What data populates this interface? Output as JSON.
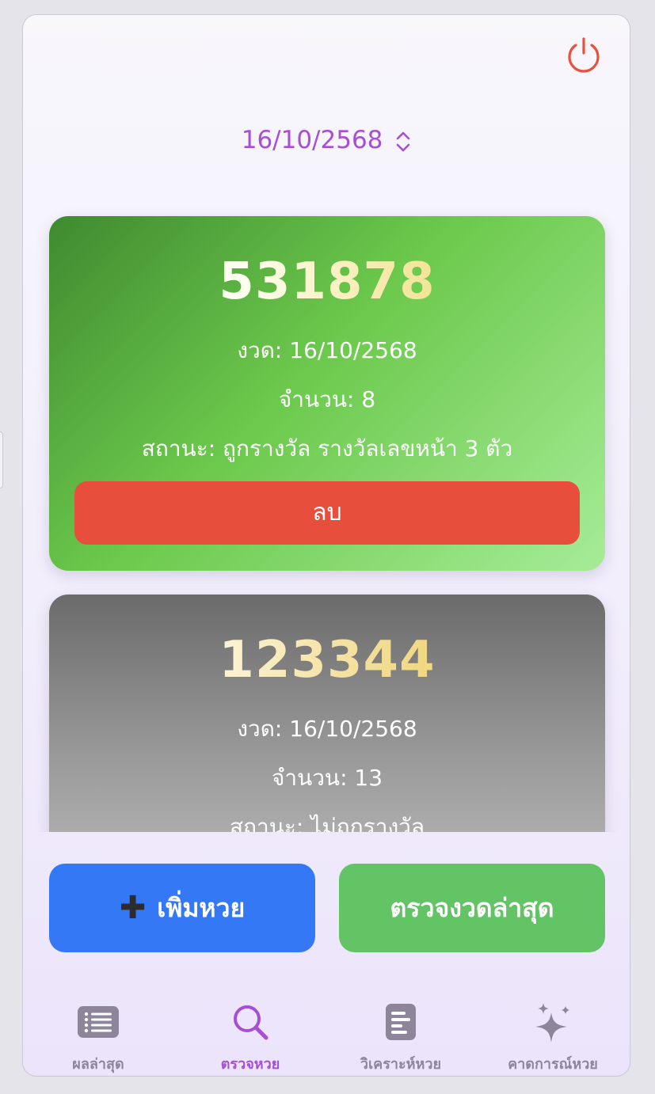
{
  "header": {
    "power_icon": "power-icon",
    "selected_date": "16/10/2568",
    "date_chevron_icon": "chevron-up-down-icon"
  },
  "tickets": [
    {
      "number": "531878",
      "draw": "งวด: 16/10/2568",
      "quantity": "จำนวน: 8",
      "status": "สถานะ: ถูกรางวัล รางวัลเลขหน้า 3 ตัว",
      "delete_label": "ลบ"
    },
    {
      "number": "123344",
      "draw": "งวด: 16/10/2568",
      "quantity": "จำนวน: 13",
      "status": "สถานะ: ไม่ถูกรางวัล"
    }
  ],
  "actions": {
    "add_label": "เพิ่มหวย",
    "check_label": "ตรวจงวดล่าสุด"
  },
  "tabs": [
    {
      "label": "ผลล่าสุด",
      "icon": "list-icon"
    },
    {
      "label": "ตรวจหวย",
      "icon": "search-icon",
      "active": true
    },
    {
      "label": "วิเคราะห์หวย",
      "icon": "document-chart-icon"
    },
    {
      "label": "คาดการณ์หวย",
      "icon": "sparkles-icon"
    }
  ],
  "colors": {
    "accent": "#a64fd3",
    "win_card": "#6cc94c",
    "lose_card": "#9a9a9a",
    "delete": "#e84e3c",
    "add_button": "#3478f6",
    "check_button": "#63c466",
    "power": "#e5533f"
  }
}
